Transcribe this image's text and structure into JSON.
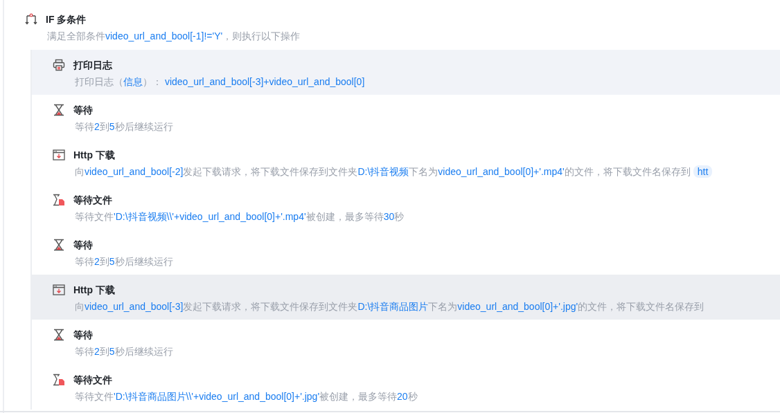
{
  "block": {
    "kind": "if",
    "title": "IF 多条件",
    "description": [
      {
        "kind": "plain",
        "text": "满足全部条件"
      },
      {
        "kind": "var",
        "text": "video_url_and_bool[-1]!='Y'"
      },
      {
        "kind": "plain",
        "text": "，则执行以下操作"
      }
    ]
  },
  "steps": [
    {
      "kind": "print",
      "title": "打印日志",
      "selected": false,
      "hovered": true,
      "description": [
        {
          "kind": "plain",
          "text": "打印日志（"
        },
        {
          "kind": "var",
          "text": "信息"
        },
        {
          "kind": "plain",
          "text": "）："
        },
        {
          "kind": "var",
          "text": " video_url_and_bool[-3]+video_url_and_bool[0]"
        }
      ]
    },
    {
      "kind": "wait",
      "title": "等待",
      "selected": false,
      "hovered": false,
      "description": [
        {
          "kind": "plain",
          "text": "等待"
        },
        {
          "kind": "var",
          "text": "2"
        },
        {
          "kind": "plain",
          "text": "到"
        },
        {
          "kind": "var",
          "text": "5"
        },
        {
          "kind": "plain",
          "text": "秒后继续运行"
        }
      ]
    },
    {
      "kind": "download",
      "title": "Http 下载",
      "selected": false,
      "hovered": false,
      "description": [
        {
          "kind": "plain",
          "text": "向"
        },
        {
          "kind": "var",
          "text": "video_url_and_bool[-2]"
        },
        {
          "kind": "plain",
          "text": "发起下载请求，将下载文件保存到文件夹"
        },
        {
          "kind": "var",
          "text": "D:\\抖音视频"
        },
        {
          "kind": "plain",
          "text": "下名为"
        },
        {
          "kind": "var",
          "text": "video_url_and_bool[0]+'.mp4'"
        },
        {
          "kind": "plain",
          "text": "的文件，将下载文件名保存到"
        },
        {
          "kind": "chip",
          "text": "htt"
        }
      ]
    },
    {
      "kind": "waitfile",
      "title": "等待文件",
      "selected": false,
      "hovered": false,
      "description": [
        {
          "kind": "plain",
          "text": "等待文件"
        },
        {
          "kind": "var",
          "text": "'D:\\抖音视频\\\\'+video_url_and_bool[0]+'.mp4'"
        },
        {
          "kind": "plain",
          "text": "被创建，最多等待"
        },
        {
          "kind": "var",
          "text": "30"
        },
        {
          "kind": "plain",
          "text": "秒"
        }
      ]
    },
    {
      "kind": "wait",
      "title": "等待",
      "selected": false,
      "hovered": false,
      "description": [
        {
          "kind": "plain",
          "text": "等待"
        },
        {
          "kind": "var",
          "text": "2"
        },
        {
          "kind": "plain",
          "text": "到"
        },
        {
          "kind": "var",
          "text": "5"
        },
        {
          "kind": "plain",
          "text": "秒后继续运行"
        }
      ]
    },
    {
      "kind": "download",
      "title": "Http 下载",
      "selected": true,
      "hovered": false,
      "description": [
        {
          "kind": "plain",
          "text": "向"
        },
        {
          "kind": "var",
          "text": "video_url_and_bool[-3]"
        },
        {
          "kind": "plain",
          "text": "发起下载请求，将下载文件保存到文件夹"
        },
        {
          "kind": "var",
          "text": "D:\\抖音商品图片"
        },
        {
          "kind": "plain",
          "text": "下名为"
        },
        {
          "kind": "var",
          "text": "video_url_and_bool[0]+'.jpg'"
        },
        {
          "kind": "plain",
          "text": "的文件，将下载文件名保存到"
        }
      ]
    },
    {
      "kind": "wait",
      "title": "等待",
      "selected": false,
      "hovered": false,
      "description": [
        {
          "kind": "plain",
          "text": "等待"
        },
        {
          "kind": "var",
          "text": "2"
        },
        {
          "kind": "plain",
          "text": "到"
        },
        {
          "kind": "var",
          "text": "5"
        },
        {
          "kind": "plain",
          "text": "秒后继续运行"
        }
      ]
    },
    {
      "kind": "waitfile",
      "title": "等待文件",
      "selected": false,
      "hovered": false,
      "description": [
        {
          "kind": "plain",
          "text": "等待文件"
        },
        {
          "kind": "var",
          "text": "'D:\\抖音商品图片\\\\'+video_url_and_bool[0]+'.jpg'"
        },
        {
          "kind": "plain",
          "text": "被创建，最多等待"
        },
        {
          "kind": "var",
          "text": "20"
        },
        {
          "kind": "plain",
          "text": "秒"
        }
      ]
    }
  ]
}
